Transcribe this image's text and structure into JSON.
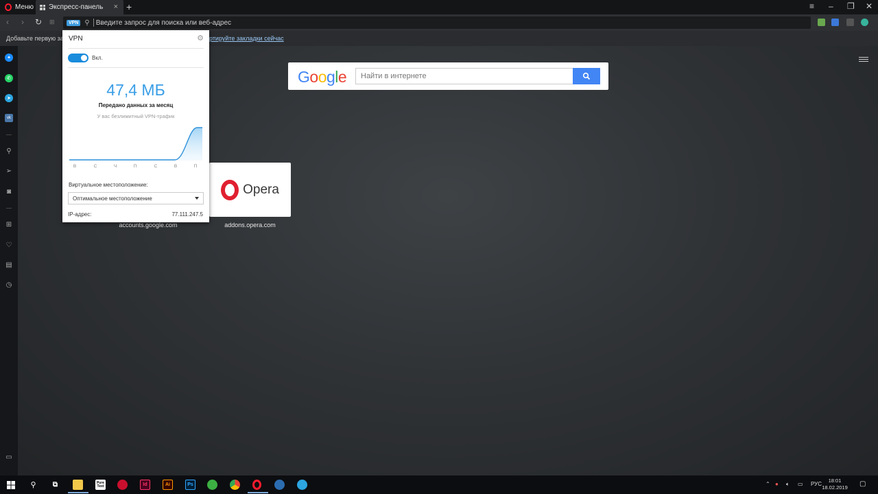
{
  "window": {
    "menu_label": "Меню",
    "tab_title": "Экспресс-панель"
  },
  "address_bar": {
    "vpn_badge": "VPN",
    "placeholder": "Введите запрос для поиска или веб-адрес"
  },
  "bookmarks_bar": {
    "hint_text": "Добавьте первую закл",
    "import_link": "ортируйте закладки сейчас"
  },
  "speed_dial": {
    "google_search": {
      "logo_letters": [
        "G",
        "o",
        "o",
        "g",
        "l",
        "e"
      ],
      "placeholder": "Найти в интернете"
    },
    "tiles": [
      {
        "name": "Opera",
        "label": "addons.opera.com"
      },
      {
        "name": "",
        "label": "accounts.google.com"
      }
    ]
  },
  "vpn_popup": {
    "title": "VPN",
    "toggle_label": "Вкл.",
    "toggle_on": true,
    "data_used": "47,4 МБ",
    "data_caption": "Передано данных за месяц",
    "unlimited_text": "У вас безлимитный VPN-трафик",
    "chart_days": [
      "В",
      "С",
      "Ч",
      "П",
      "С",
      "В",
      "П"
    ],
    "location_label": "Виртуальное местоположение:",
    "location_value": "Оптимальное местоположение",
    "ip_label": "IP-адрес:",
    "ip_value": "77.111.247.5"
  },
  "taskbar": {
    "language": "РУС",
    "time": "18:01",
    "date": "18.02.2019",
    "apps": [
      "Start",
      "Search",
      "Task View",
      "File Explorer",
      "PureText",
      "App",
      "InDesign",
      "Illustrator",
      "Photoshop",
      "App",
      "Chrome",
      "Opera",
      "App",
      "Telegram"
    ],
    "app_labels": {
      "puretext": "Pure Text",
      "indesign": "Id",
      "illustrator": "Ai",
      "photoshop": "Ps"
    }
  },
  "colors": {
    "opera_red": "#ff1b2d",
    "vpn_blue": "#3a9ee6",
    "google_blue": "#4285f4",
    "taskbar": "#0c0d10"
  }
}
